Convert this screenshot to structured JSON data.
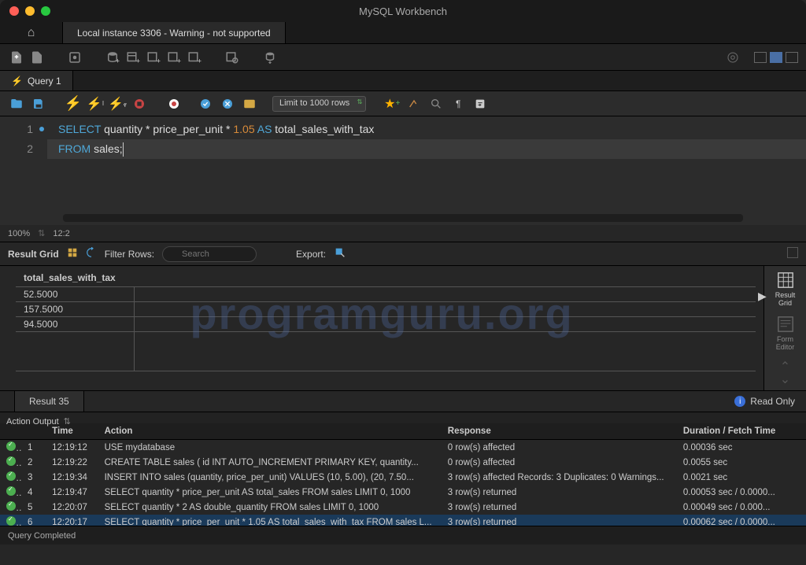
{
  "app_title": "MySQL Workbench",
  "connection_tab": "Local instance 3306 - Warning - not supported",
  "query_tab": "Query 1",
  "limit_label": "Limit to 1000 rows",
  "zoom": "100%",
  "cursor_pos": "12:2",
  "code": {
    "line1": {
      "kw1": "SELECT",
      "rest1": " quantity ",
      "op1": "*",
      "rest2": " price_per_unit ",
      "op2": "*",
      "num": " 1.05",
      "kw2": " AS",
      "rest3": " total_sales_with_tax"
    },
    "line2": {
      "kw1": "FROM",
      "rest": " sales;"
    }
  },
  "result_toolbar": {
    "label": "Result Grid",
    "filter_label": "Filter Rows:",
    "filter_placeholder": "Search",
    "export_label": "Export:"
  },
  "watermark": "programguru.org",
  "result_header": "total_sales_with_tax",
  "result_rows": [
    "52.5000",
    "157.5000",
    "94.5000"
  ],
  "side": {
    "grid": "Result\nGrid",
    "form": "Form\nEditor"
  },
  "result_tab": "Result 35",
  "read_only": "Read Only",
  "output_label": "Action Output",
  "output_cols": {
    "time": "Time",
    "action": "Action",
    "response": "Response",
    "duration": "Duration / Fetch Time"
  },
  "output_rows": [
    {
      "idx": "1",
      "time": "12:19:12",
      "action": "USE mydatabase",
      "response": "0 row(s) affected",
      "duration": "0.00036 sec"
    },
    {
      "idx": "2",
      "time": "12:19:22",
      "action": "CREATE TABLE sales (     id INT AUTO_INCREMENT PRIMARY KEY,     quantity...",
      "response": "0 row(s) affected",
      "duration": "0.0055 sec"
    },
    {
      "idx": "3",
      "time": "12:19:34",
      "action": "INSERT INTO sales (quantity, price_per_unit) VALUES (10, 5.00),     (20, 7.50...",
      "response": "3 row(s) affected Records: 3  Duplicates: 0  Warnings...",
      "duration": "0.0021 sec"
    },
    {
      "idx": "4",
      "time": "12:19:47",
      "action": "SELECT quantity * price_per_unit AS total_sales FROM sales LIMIT 0, 1000",
      "response": "3 row(s) returned",
      "duration": "0.00053 sec / 0.0000..."
    },
    {
      "idx": "5",
      "time": "12:20:07",
      "action": "SELECT quantity * 2 AS double_quantity FROM sales LIMIT 0, 1000",
      "response": "3 row(s) returned",
      "duration": "0.00049 sec / 0.000..."
    },
    {
      "idx": "6",
      "time": "12:20:17",
      "action": "SELECT quantity * price_per_unit * 1.05 AS total_sales_with_tax FROM sales L...",
      "response": "3 row(s) returned",
      "duration": "0.00062 sec / 0.0000..."
    }
  ],
  "status": "Query Completed"
}
